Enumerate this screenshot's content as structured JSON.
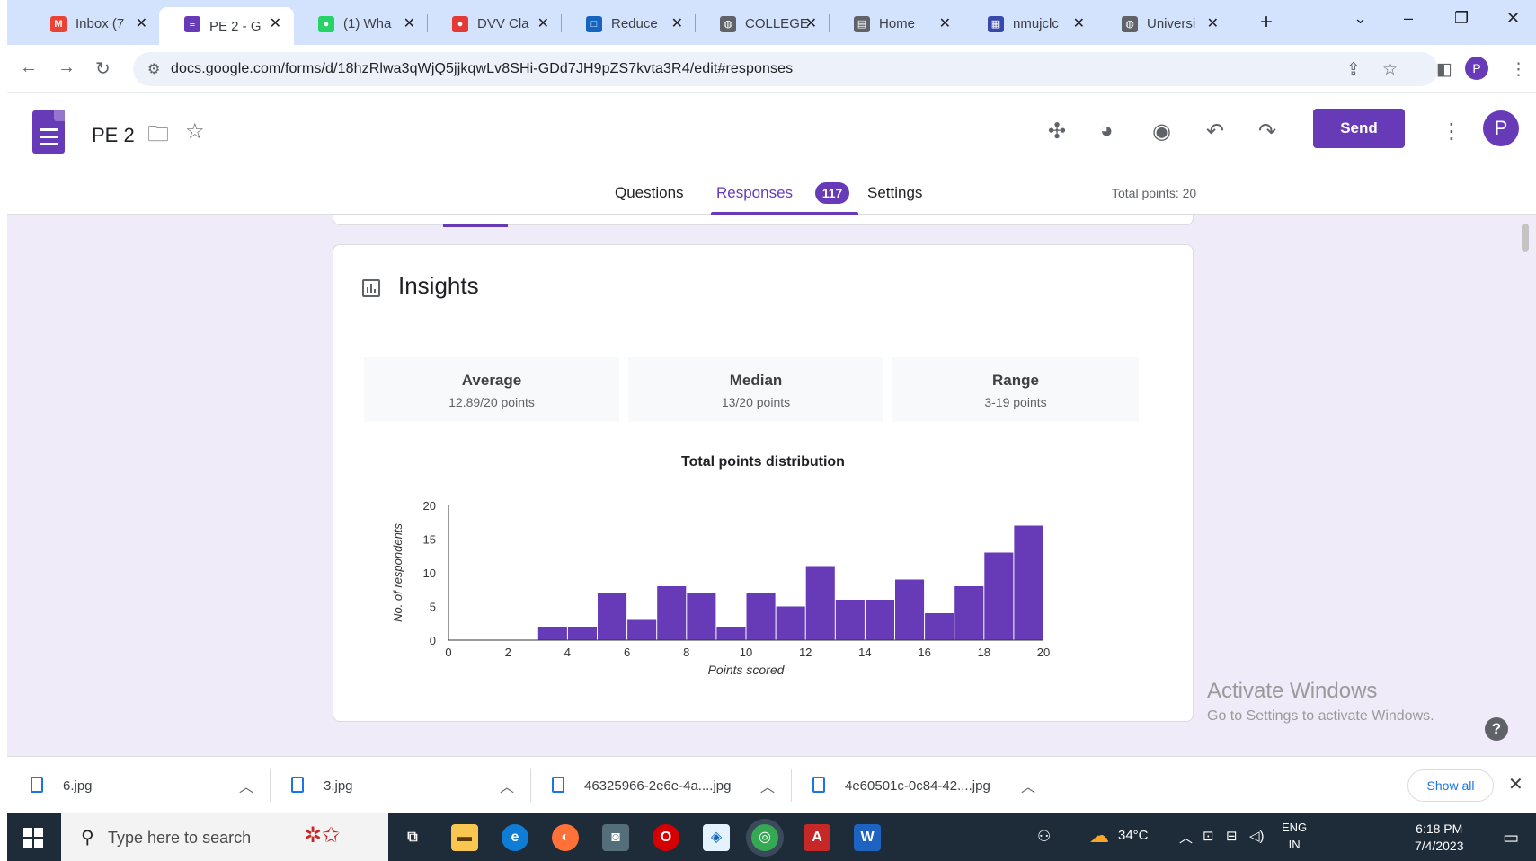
{
  "browser": {
    "tabs": [
      {
        "label": "Inbox (7",
        "favicon": "gmail-icon",
        "color": "#ea4335",
        "glyph": "M"
      },
      {
        "label": "PE 2 - G",
        "favicon": "forms-icon",
        "color": "#673ab7",
        "glyph": "≡",
        "active": true
      },
      {
        "label": "(1) Wha",
        "favicon": "whatsapp-icon",
        "color": "#25d366",
        "glyph": "●"
      },
      {
        "label": "DVV Cla",
        "favicon": "dvv-icon",
        "color": "#e53935",
        "glyph": "●"
      },
      {
        "label": "Reduce",
        "favicon": "reduce-icon",
        "color": "#1565c0",
        "glyph": "□"
      },
      {
        "label": "COLLEGE",
        "favicon": "globe-icon",
        "color": "#5f6368",
        "glyph": "◍"
      },
      {
        "label": "Home",
        "favicon": "printer-icon",
        "color": "#5f6368",
        "glyph": "▤"
      },
      {
        "label": "nmujclc",
        "favicon": "site-icon",
        "color": "#3949ab",
        "glyph": "▦"
      },
      {
        "label": "Universi",
        "favicon": "globe-icon",
        "color": "#5f6368",
        "glyph": "◍"
      }
    ],
    "url": "docs.google.com/forms/d/18hzRlwa3qWjQ5jjkqwLv8SHi-GDd7JH9pZS7kvta3R4/edit#responses"
  },
  "form": {
    "title": "PE 2",
    "send_label": "Send",
    "avatar_letter": "P",
    "tabs": {
      "questions": "Questions",
      "responses": "Responses",
      "settings": "Settings"
    },
    "responses_count": "117",
    "total_points": "Total points: 20"
  },
  "insights": {
    "title": "Insights",
    "stats": [
      {
        "label": "Average",
        "value": "12.89/20 points"
      },
      {
        "label": "Median",
        "value": "13/20 points"
      },
      {
        "label": "Range",
        "value": "3-19 points"
      }
    ]
  },
  "chart_data": {
    "type": "bar",
    "title": "Total points distribution",
    "xlabel": "Points scored",
    "ylabel": "No. of respondents",
    "x": [
      3,
      4,
      5,
      6,
      7,
      8,
      9,
      10,
      11,
      12,
      13,
      14,
      15,
      16,
      17,
      18,
      19
    ],
    "values": [
      2,
      2,
      7,
      3,
      8,
      7,
      2,
      7,
      5,
      11,
      6,
      6,
      9,
      4,
      8,
      13,
      17
    ],
    "xlim": [
      0,
      20
    ],
    "ylim": [
      0,
      20
    ],
    "xticks": [
      0,
      2,
      4,
      6,
      8,
      10,
      12,
      14,
      16,
      18,
      20
    ],
    "yticks": [
      0,
      5,
      10,
      15,
      20
    ],
    "bar_color": "#673ab7",
    "grid": false
  },
  "watermark": {
    "line1": "Activate Windows",
    "line2": "Go to Settings to activate Windows."
  },
  "downloads": {
    "files": [
      "6.jpg",
      "3.jpg",
      "46325966-2e6e-4a....jpg",
      "4e60501c-0c84-42....jpg"
    ],
    "show_all": "Show all"
  },
  "taskbar": {
    "search_placeholder": "Type here to search",
    "weather": "34°C",
    "lang_line1": "ENG",
    "lang_line2": "IN",
    "time": "6:18 PM",
    "date": "7/4/2023"
  },
  "colors": {
    "accent": "#673ab7",
    "background": "#f0ebf8"
  }
}
